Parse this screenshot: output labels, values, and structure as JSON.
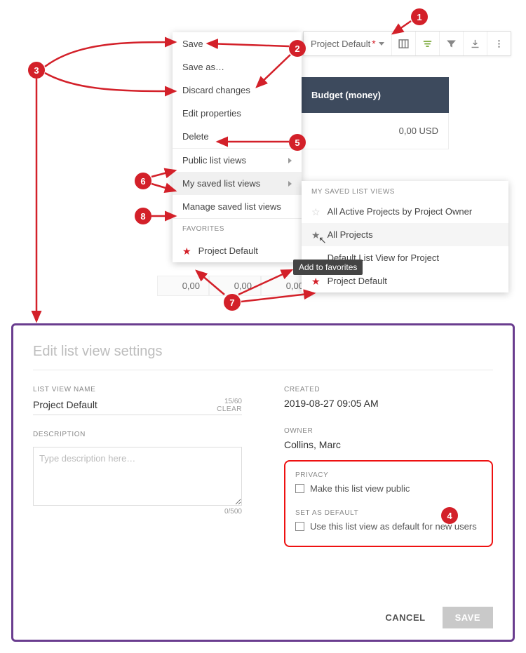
{
  "toolbar": {
    "view_label": "Project Default",
    "modified_marker": "*"
  },
  "menu": {
    "save": "Save",
    "save_as": "Save as…",
    "discard": "Discard changes",
    "edit_properties": "Edit properties",
    "delete": "Delete",
    "public_views": "Public list views",
    "my_saved": "My saved list views",
    "manage": "Manage saved list views",
    "favorites_header": "FAVORITES",
    "favorite_1": "Project Default"
  },
  "submenu": {
    "header": "MY SAVED LIST VIEWS",
    "items": [
      "All Active Projects by Project Owner",
      "All Projects",
      "Default List View for Project",
      "Project Default"
    ]
  },
  "tooltip": "Add to favorites",
  "table": {
    "col_header": "Budget (money)",
    "cell_value": "0,00 USD",
    "footer_cells": [
      "0,00",
      "0,00",
      "0,00"
    ]
  },
  "modal": {
    "title": "Edit list view settings",
    "name_label": "LIST VIEW NAME",
    "name_value": "Project Default",
    "name_counter": "15/60",
    "clear": "CLEAR",
    "description_label": "DESCRIPTION",
    "description_placeholder": "Type description here…",
    "desc_counter": "0/500",
    "created_label": "CREATED",
    "created_value": "2019-08-27 09:05 AM",
    "owner_label": "OWNER",
    "owner_value": "Collins, Marc",
    "privacy_label": "PRIVACY",
    "privacy_chk": "Make this list view public",
    "default_label": "SET AS DEFAULT",
    "default_chk": "Use this list view as default for new users",
    "cancel": "CANCEL",
    "save": "SAVE"
  },
  "icons": {
    "columns": "columns-icon",
    "filter_lines": "filter-lines-icon",
    "funnel": "funnel-icon",
    "download": "download-icon",
    "kebab": "kebab-icon"
  }
}
